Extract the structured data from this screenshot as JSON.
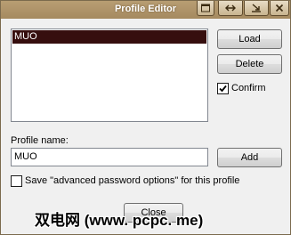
{
  "window": {
    "title": "Profile Editor"
  },
  "profiles": {
    "items": [
      "MUO"
    ]
  },
  "buttons": {
    "load": "Load",
    "delete": "Delete",
    "add": "Add",
    "close": "Close"
  },
  "confirm": {
    "label": "Confirm",
    "checked": true
  },
  "profile_name": {
    "label": "Profile name:",
    "value": "MUO"
  },
  "advanced": {
    "label": "Save \"advanced password options\" for this profile",
    "checked": false
  },
  "watermark": {
    "text": "双电网 (www. pcpc. me)"
  },
  "colors": {
    "titlebar": "#a58a60",
    "selection": "#360e0e"
  }
}
